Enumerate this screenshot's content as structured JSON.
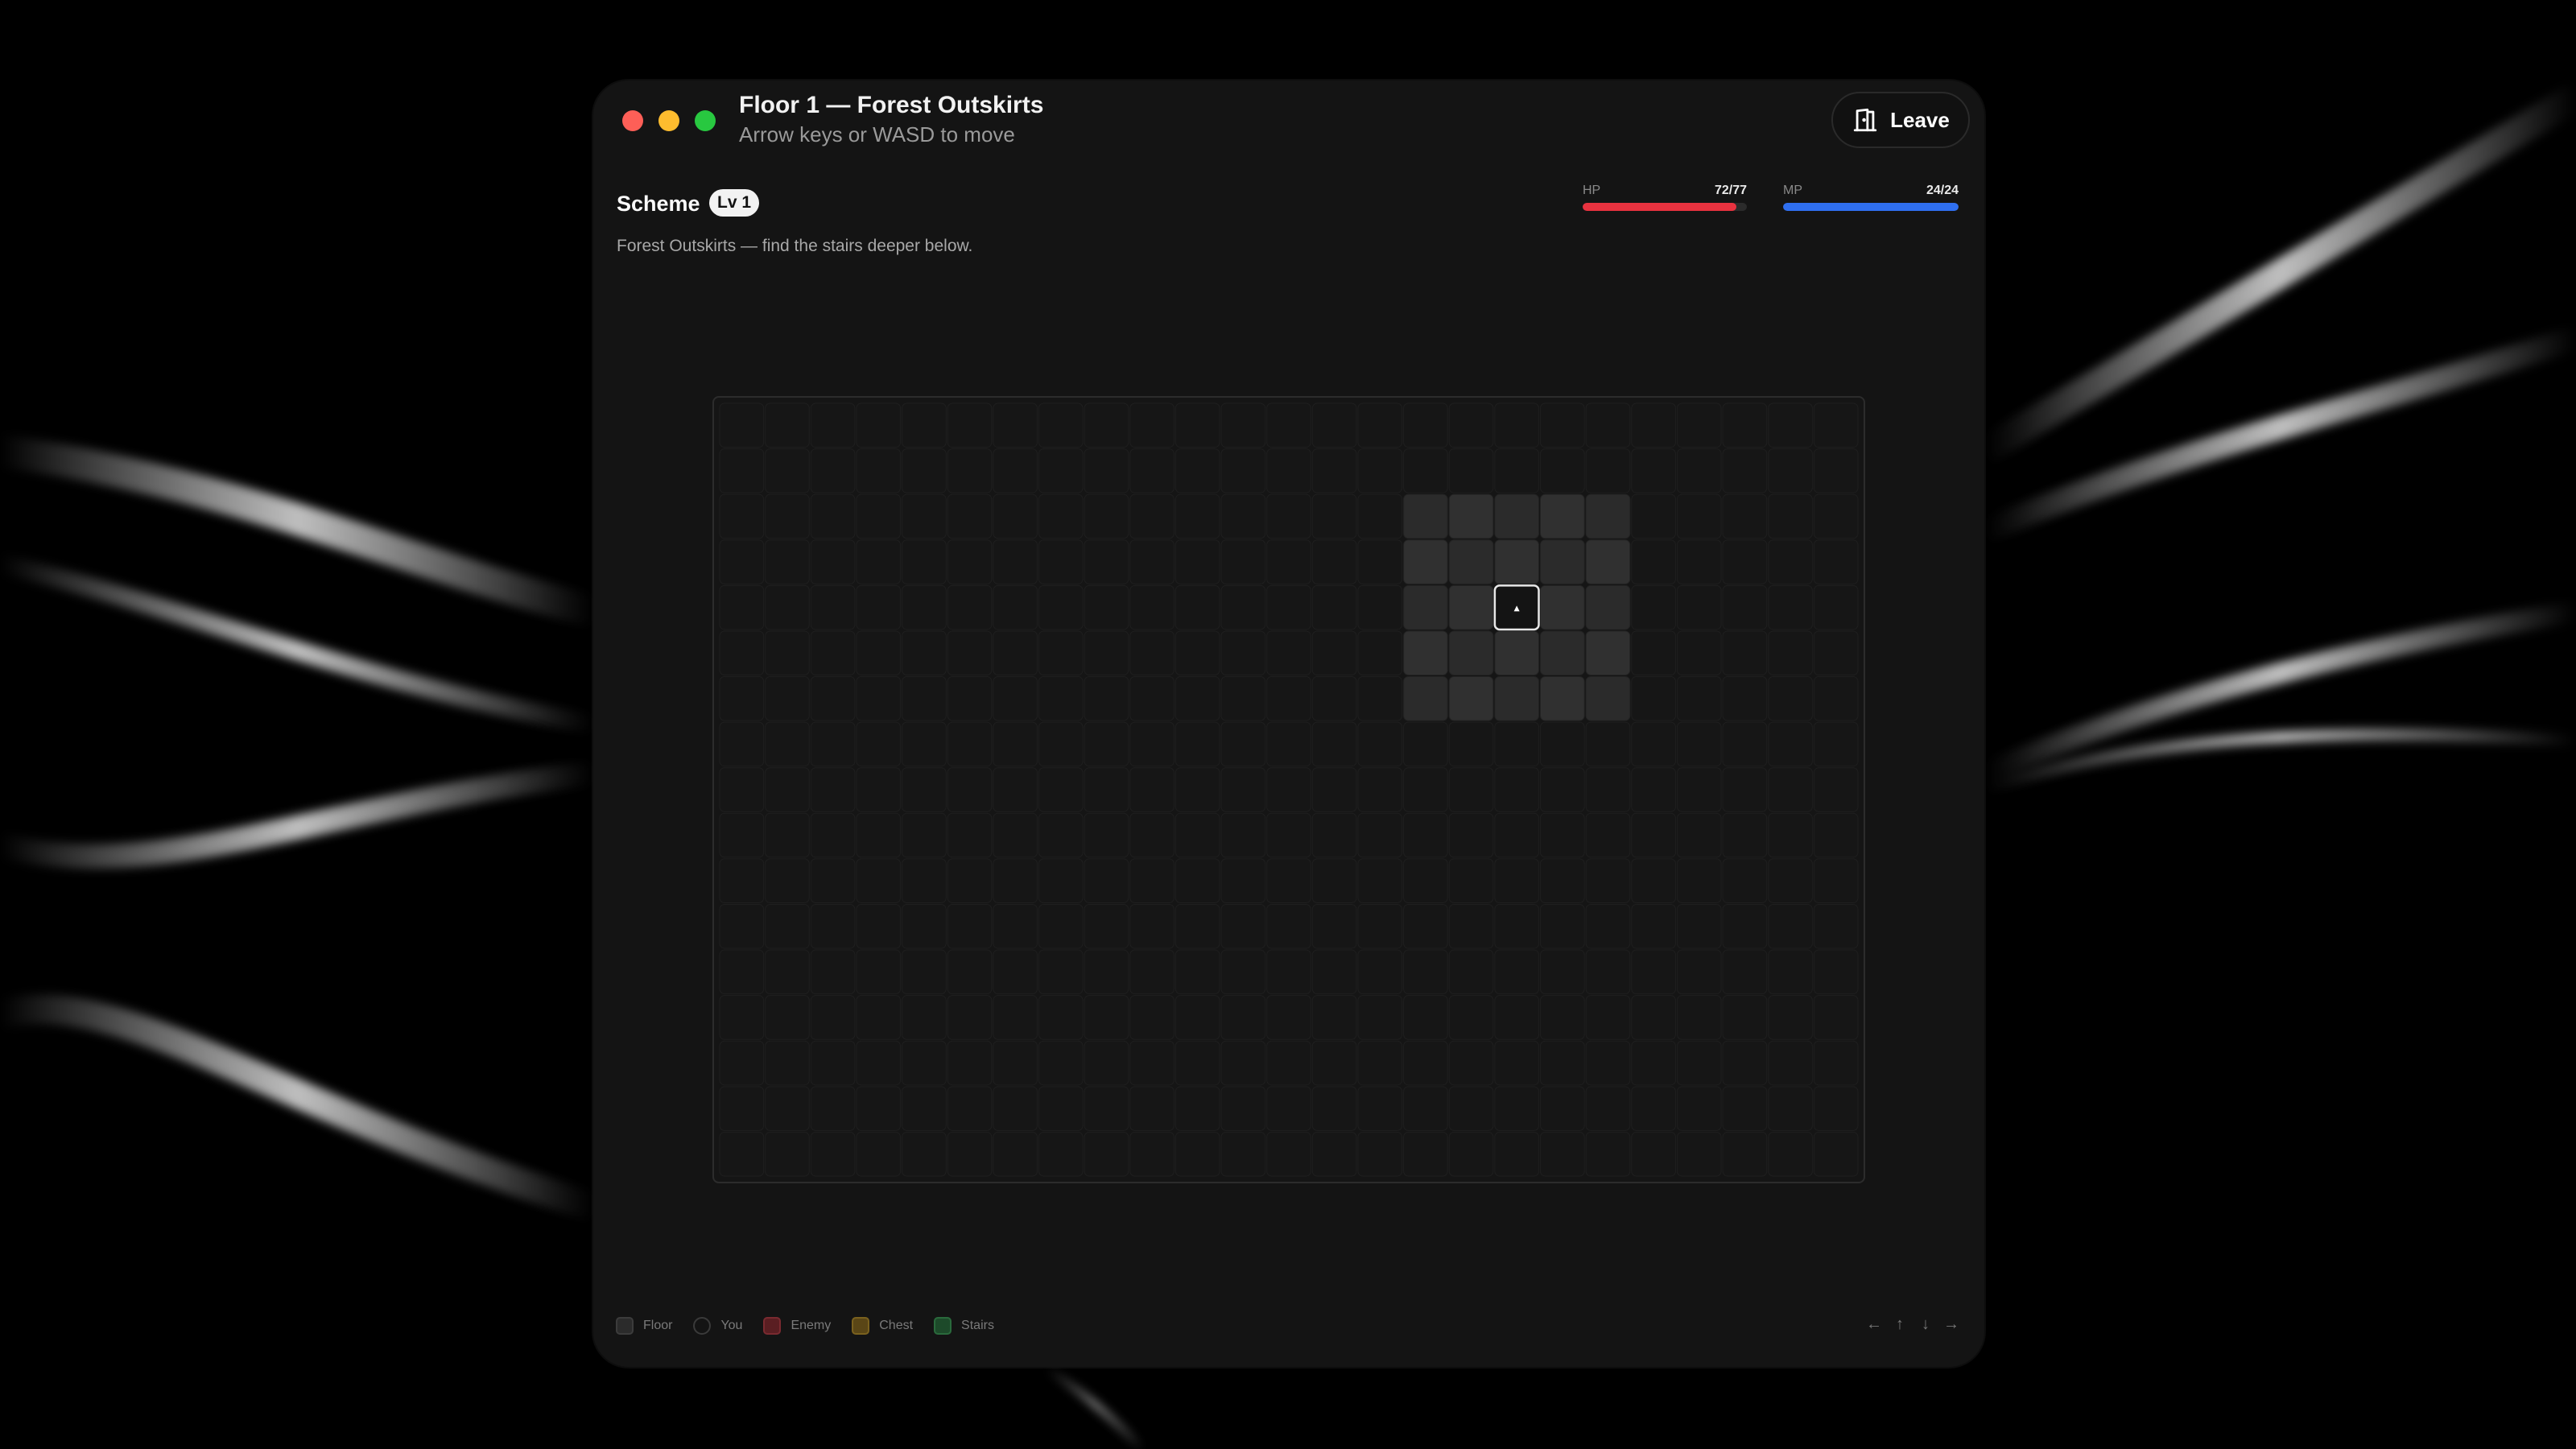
{
  "window": {
    "title": "Floor 1 — Forest Outskirts",
    "subtitle": "Arrow keys or WASD to move",
    "leave_label": "Leave",
    "leave_icon": "door-exit-icon"
  },
  "player": {
    "name": "Scheme",
    "level": "Lv 1",
    "flavor": "Forest Outskirts — find the stairs deeper below."
  },
  "stats": {
    "hp": {
      "label": "HP",
      "value": "72/77",
      "current": 72,
      "max": 77,
      "color": "#e8323f"
    },
    "mp": {
      "label": "MP",
      "value": "24/24",
      "current": 24,
      "max": 24,
      "color": "#2f6ff0"
    }
  },
  "map": {
    "columns": 25,
    "rows": 17,
    "revealed": {
      "col_start": 15,
      "col_end": 19,
      "row_start": 2,
      "row_end": 6
    },
    "player": {
      "col": 17,
      "row": 4,
      "glyph": "▴"
    }
  },
  "legend": [
    {
      "label": "Floor",
      "color": "#2b2b2b",
      "outline": "#3c3c3c"
    },
    {
      "label": "You",
      "color": "#141414",
      "outline": "#3a3a3a"
    },
    {
      "label": "Enemy",
      "color": "#5a1e22",
      "outline": "#7a2a30"
    },
    {
      "label": "Chest",
      "color": "#5a4616",
      "outline": "#7a611e"
    },
    {
      "label": "Stairs",
      "color": "#1d4a2a",
      "outline": "#2a6a3c"
    }
  ],
  "controls": {
    "left": "←",
    "up": "↑",
    "down": "↓",
    "right": "→"
  }
}
